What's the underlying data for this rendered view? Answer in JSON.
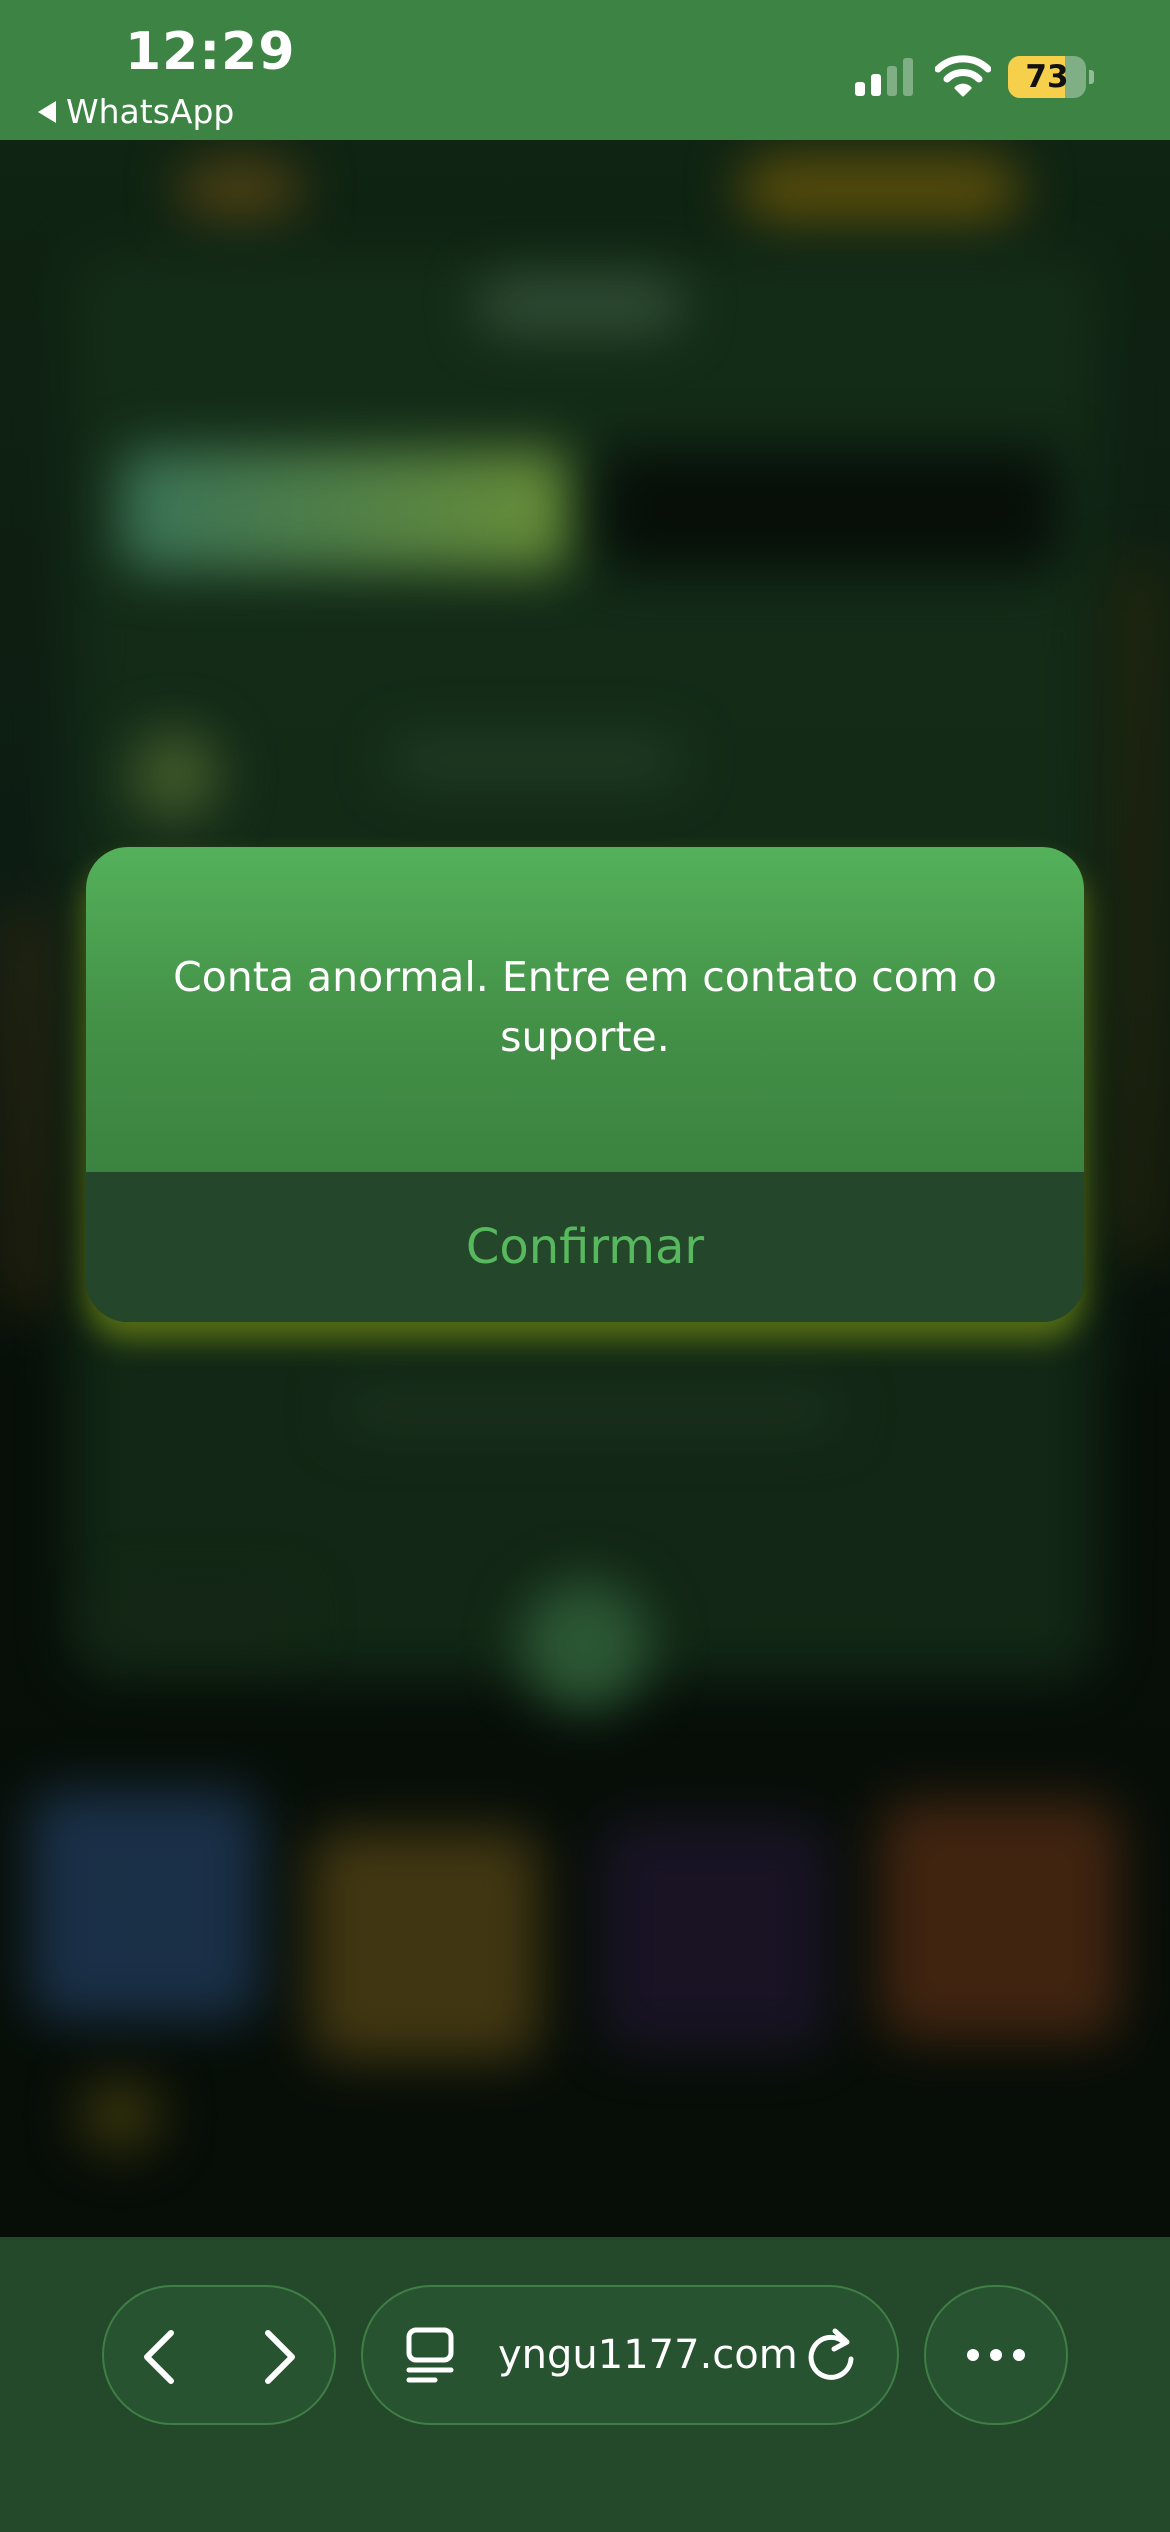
{
  "status_bar": {
    "time": "12:29",
    "back_app": "WhatsApp",
    "battery_level": "73",
    "battery_fraction": 0.73,
    "signal_bars_active": 2,
    "signal_bars_total": 4
  },
  "dialog": {
    "message": "Conta anormal. Entre em contato com o suporte.",
    "confirm_label": "Confirmar"
  },
  "toolbar": {
    "url": "yngu1177.com"
  },
  "icons": {
    "back": "chevron-left-icon",
    "forward": "chevron-right-icon",
    "tabs": "tabs-icon",
    "reload": "reload-icon",
    "more": "more-dots-icon",
    "wifi": "wifi-icon",
    "signal": "cellular-signal-icon"
  },
  "colors": {
    "status_bar": "#3d8444",
    "dialog_top": "#54b15a",
    "dialog_footer": "#24472b",
    "confirm_text": "#58b85e",
    "toolbar": "#23482a",
    "battery": "#f6d04a"
  }
}
